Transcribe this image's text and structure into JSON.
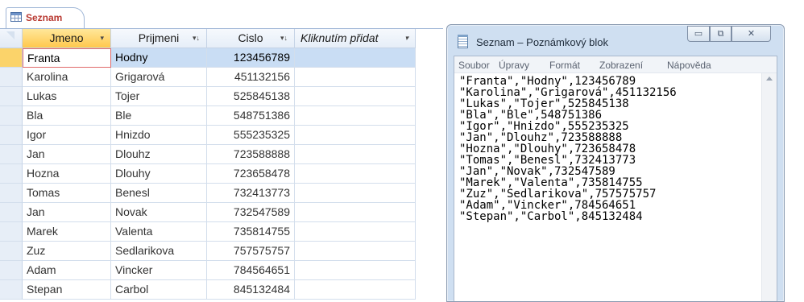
{
  "access": {
    "tab_label": "Seznam",
    "columns": [
      {
        "label": "Jmeno",
        "arrow": "▾"
      },
      {
        "label": "Prijmeni",
        "arrow": "▾↓"
      },
      {
        "label": "Cislo",
        "arrow": "▾↓"
      },
      {
        "label": "Kliknutím přidat",
        "arrow": "▾"
      }
    ],
    "rows": [
      [
        "Franta",
        "Hodny",
        "123456789"
      ],
      [
        "Karolina",
        "Grigarová",
        "451132156"
      ],
      [
        "Lukas",
        "Tojer",
        "525845138"
      ],
      [
        "Bla",
        "Ble",
        "548751386"
      ],
      [
        "Igor",
        "Hnizdo",
        "555235325"
      ],
      [
        "Jan",
        "Dlouhz",
        "723588888"
      ],
      [
        "Hozna",
        "Dlouhy",
        "723658478"
      ],
      [
        "Tomas",
        "Benesl",
        "732413773"
      ],
      [
        "Jan",
        "Novak",
        "732547589"
      ],
      [
        "Marek",
        "Valenta",
        "735814755"
      ],
      [
        "Zuz",
        "Sedlarikova",
        "757575757"
      ],
      [
        "Adam",
        "Vincker",
        "784564651"
      ],
      [
        "Stepan",
        "Carbol",
        "845132484"
      ]
    ]
  },
  "notepad": {
    "title": "Seznam – Poznámkový blok",
    "menu": [
      "Soubor",
      "Úpravy",
      "Formát",
      "Zobrazení",
      "Nápověda"
    ],
    "window_buttons": {
      "minimize": "▭",
      "maximize": "⧉",
      "close": "✕"
    },
    "lines": [
      "\"Franta\",\"Hodny\",123456789",
      "\"Karolina\",\"Grigarová\",451132156",
      "\"Lukas\",\"Tojer\",525845138",
      "\"Bla\",\"Ble\",548751386",
      "\"Igor\",\"Hnizdo\",555235325",
      "\"Jan\",\"Dlouhz\",723588888",
      "\"Hozna\",\"Dlouhy\",723658478",
      "\"Tomas\",\"Benesl\",732413773",
      "\"Jan\",\"Novak\",732547589",
      "\"Marek\",\"Valenta\",735814755",
      "\"Zuz\",\"Sedlarikova\",757575757",
      "\"Adam\",\"Vincker\",784564651",
      "\"Stepan\",\"Carbol\",845132484"
    ]
  }
}
